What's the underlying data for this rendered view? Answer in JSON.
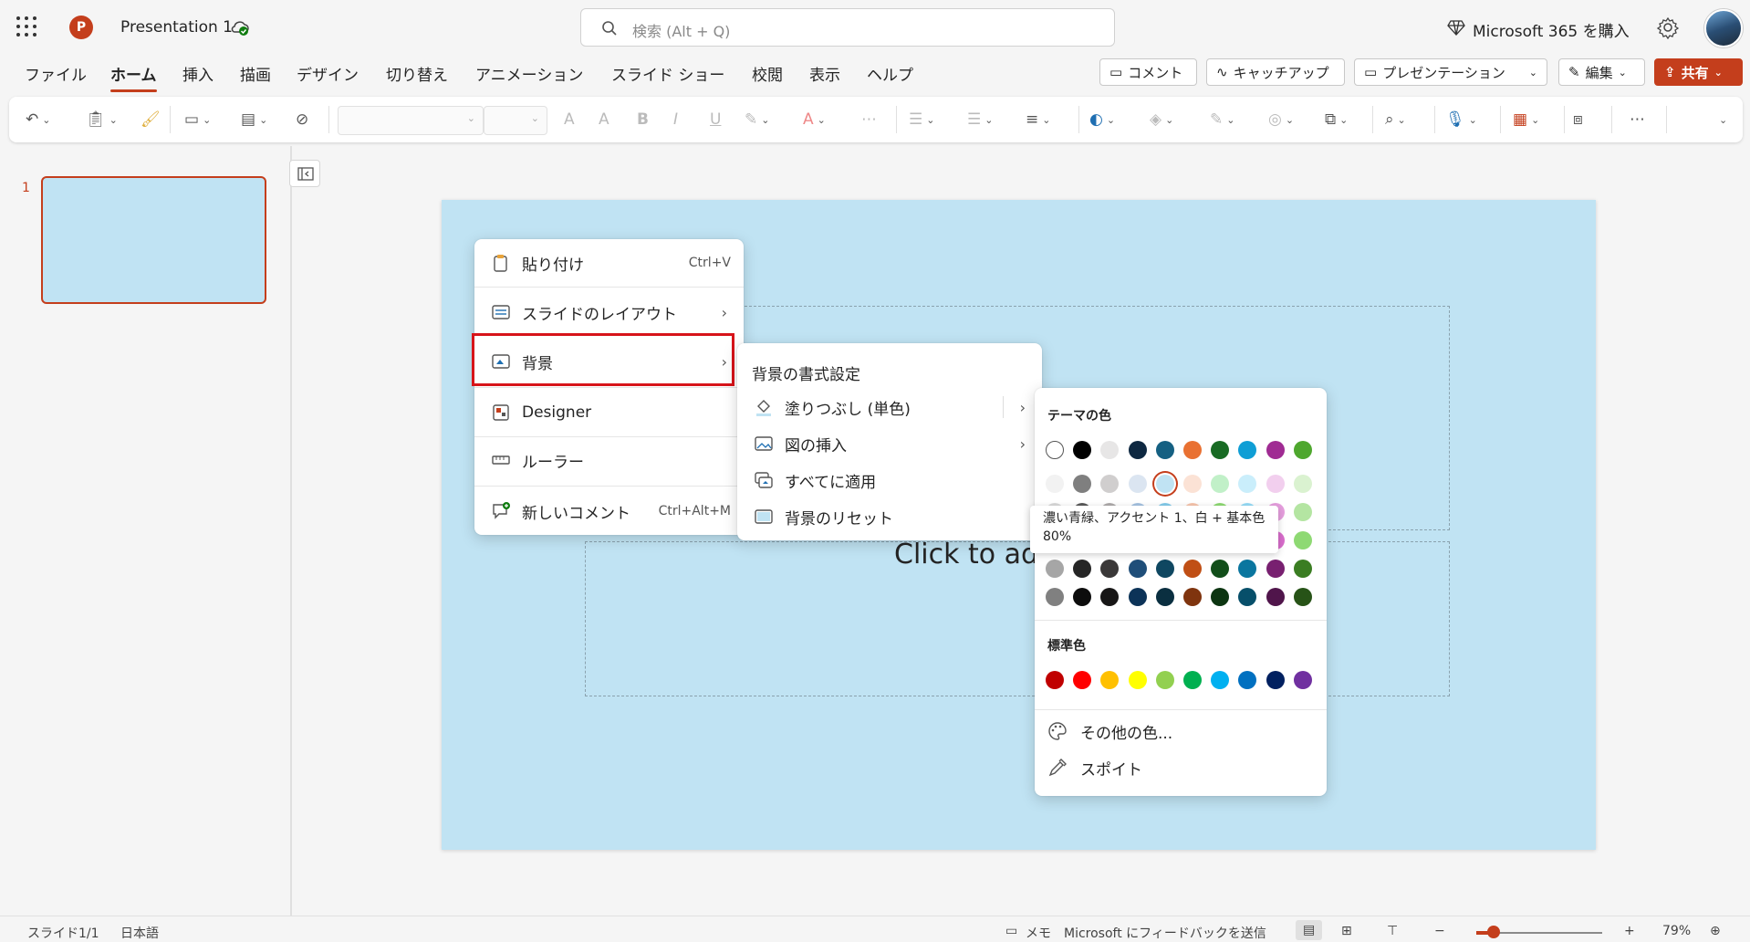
{
  "app": {
    "doc_title": "Presentation 1",
    "search_placeholder": "検索 (Alt + Q)",
    "buy_label": "Microsoft 365 を購入"
  },
  "tabs": [
    "ファイル",
    "ホーム",
    "挿入",
    "描画",
    "デザイン",
    "切り替え",
    "アニメーション",
    "スライド ショー",
    "校閲",
    "表示",
    "ヘルプ"
  ],
  "active_tab": "ホーム",
  "top_buttons": {
    "comment": "コメント",
    "catchup": "キャッチアップ",
    "present": "プレゼンテーション",
    "edit": "編集",
    "share": "共有"
  },
  "slide_panel": {
    "slide_number": "1"
  },
  "slide": {
    "body_placeholder": "Click to add"
  },
  "context_menu": {
    "items": [
      {
        "label": "貼り付け",
        "shortcut": "Ctrl+V"
      },
      {
        "label": "スライドのレイアウト",
        "submenu": true
      },
      {
        "label": "背景",
        "submenu": true
      },
      {
        "label": "Designer"
      },
      {
        "label": "ルーラー"
      },
      {
        "label": "新しいコメント",
        "shortcut": "Ctrl+Alt+M"
      }
    ]
  },
  "background_submenu": {
    "header": "背景の書式設定",
    "items": [
      {
        "label": "塗りつぶし (単色)",
        "submenu": true
      },
      {
        "label": "図の挿入",
        "submenu": true
      },
      {
        "label": "すべてに適用"
      },
      {
        "label": "背景のリセット"
      }
    ]
  },
  "color_palette": {
    "theme_title": "テーマの色",
    "standard_title": "標準色",
    "more_colors": "その他の色...",
    "eyedropper": "スポイト",
    "tooltip": "濃い青緑、アクセント 1、白 + 基本色 80%",
    "theme_top_row": [
      "#ffffff",
      "#000000",
      "#e7e6e6",
      "#0e2841",
      "#156082",
      "#e97132",
      "#196b24",
      "#0f9ed5",
      "#a02b93",
      "#4ea72e"
    ],
    "theme_rows": [
      [
        "#f2f2f2",
        "#7f7f7f",
        "#d0cece",
        "#dbe5f1",
        "#c0e3f3",
        "#fbe2d5",
        "#c1f0c8",
        "#caeefb",
        "#f2cfee",
        "#daf2d0"
      ],
      [
        "#d9d9d9",
        "#595959",
        "#aeabab",
        "#a5c2e1",
        "#83cbeb",
        "#f7c5ac",
        "#8ed973",
        "#95dcf7",
        "#e59edd",
        "#b4e5a2"
      ],
      [
        "#bfbfbf",
        "#404040",
        "#747070",
        "#6d9bcf",
        "#44b3e1",
        "#f3a77f",
        "#47d45a",
        "#61cbf3",
        "#d86dcb",
        "#8ed973"
      ],
      [
        "#a6a6a6",
        "#262626",
        "#3a3838",
        "#1f4e79",
        "#0f4761",
        "#c04f15",
        "#124e1a",
        "#0b769f",
        "#782070",
        "#3a7d22"
      ],
      [
        "#808080",
        "#0d0d0d",
        "#171616",
        "#0c3358",
        "#0a2f40",
        "#7f340e",
        "#0c3511",
        "#074f6a",
        "#50154b",
        "#275317"
      ]
    ],
    "standard": [
      "#c00000",
      "#ff0000",
      "#ffc000",
      "#ffff00",
      "#92d050",
      "#00b050",
      "#00b0f0",
      "#0070c0",
      "#002060",
      "#7030a0"
    ]
  },
  "status_bar": {
    "slide_info": "スライド1/1",
    "language": "日本語",
    "notes": "メモ",
    "feedback": "Microsoft にフィードバックを送信",
    "zoom": "79%",
    "zoom_fraction": 0.14
  },
  "colors": {
    "accent": "#c43e1c",
    "slide_bg": "#c0e3f3",
    "highlight_border": "#d7141a"
  }
}
